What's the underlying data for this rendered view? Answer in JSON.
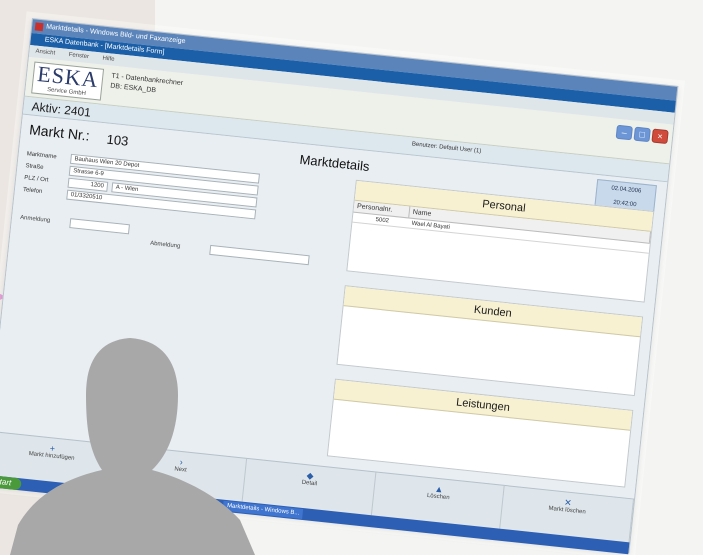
{
  "window": {
    "outer_title": "Marktdetails - Windows Bild- und Faxanzeige",
    "inner_title": "ESKA Datenbank - [Marktdetails Form]"
  },
  "menu": {
    "items": [
      "Ansicht",
      "Fenster",
      "Hilfe"
    ]
  },
  "brand": {
    "logo_big": "ESKA",
    "logo_small": "Service GmbH",
    "db_line1": "T1 - Datenbankrechner",
    "db_line2": "DB: ESKA_DB"
  },
  "status": {
    "aktiv": "Aktiv: 2401",
    "benutzer": "Benutzer: Default User (1)",
    "date": "02.04.2006",
    "time": "20:42:00"
  },
  "market": {
    "label": "Markt Nr.:",
    "number": "103",
    "heading": "Marktdetails"
  },
  "form": {
    "marktname_label": "Marktname",
    "marktname_value": "Bauhaus Wien 20 Depot",
    "strasse_label": "Straße",
    "strasse_value": "Strasse 6-9",
    "plz_label": "PLZ / Ort",
    "plz_value": "1200",
    "ort_value": "A - Wien",
    "telefon_label": "Telefon",
    "telefon_value": "01/3320510",
    "anmeldung_label": "Anmeldung",
    "abmeldung_label": "Abmeldung"
  },
  "personal": {
    "title": "Personal",
    "columns": [
      "Personalnr.",
      "Name"
    ],
    "rows": [
      {
        "nr": "5002",
        "name": "Wael Al Bayati"
      }
    ]
  },
  "kunden": {
    "title": "Kunden"
  },
  "leistungen": {
    "title": "Leistungen"
  },
  "buttons": {
    "markt_hinzufuegen": "Markt hinzufügen",
    "next": "Next",
    "detail": "Detail",
    "loeschen": "Löschen",
    "markt_loeschen": "Markt löschen"
  },
  "taskbar": {
    "start": "Start",
    "task": "Marktdetails - Windows B..."
  }
}
